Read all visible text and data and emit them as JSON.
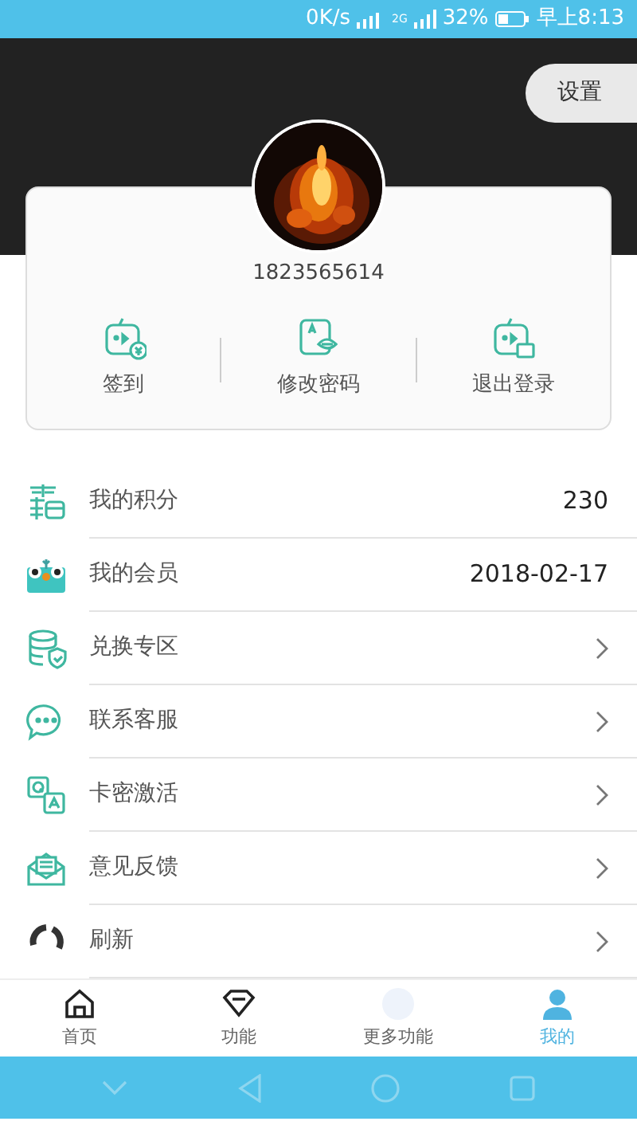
{
  "status_bar": {
    "speed": "0K/s",
    "network": "2G",
    "battery": "32%",
    "time": "早上8:13"
  },
  "header": {
    "settings": "设置"
  },
  "profile": {
    "phone": "1823565614"
  },
  "actions": [
    {
      "label": "签到",
      "kind": "checkin"
    },
    {
      "label": "修改密码",
      "kind": "password"
    },
    {
      "label": "退出登录",
      "kind": "logout"
    }
  ],
  "menu": [
    {
      "label": "我的积分",
      "kind": "points",
      "value": "230"
    },
    {
      "label": "我的会员",
      "kind": "member",
      "value": "2018-02-17"
    },
    {
      "label": "兑换专区",
      "kind": "exchange",
      "chevron": true
    },
    {
      "label": "联系客服",
      "kind": "service",
      "chevron": true
    },
    {
      "label": "卡密激活",
      "kind": "qa",
      "chevron": true
    },
    {
      "label": "意见反馈",
      "kind": "feedback",
      "chevron": true
    },
    {
      "label": "刷新",
      "kind": "refresh",
      "chevron": true
    }
  ],
  "tabs": [
    {
      "label": "首页",
      "kind": "home",
      "selected": false
    },
    {
      "label": "功能",
      "kind": "gem",
      "selected": false
    },
    {
      "label": "更多功能",
      "kind": "more",
      "selected": false
    },
    {
      "label": "我的",
      "kind": "user",
      "selected": true
    }
  ]
}
